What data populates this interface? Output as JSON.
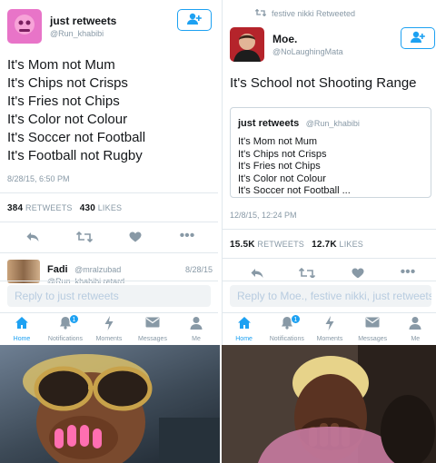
{
  "left": {
    "user": {
      "name": "just retweets",
      "handle": "@Run_khabibi"
    },
    "tweet_text": "It's Mom not Mum\nIt's Chips not Crisps\nIt's Fries not Chips\nIt's Color not Colour\nIt's Soccer not Football\nIt's Football not Rugby",
    "timestamp": "8/28/15, 6:50 PM",
    "retweet_count": "384",
    "retweets_label": "RETWEETS",
    "like_count": "430",
    "likes_label": "LIKES",
    "reply_preview": {
      "name": "Fadi",
      "handle": "@mralzubad",
      "date": "8/28/15",
      "snippet": "@Run_khabibi retard"
    },
    "reply_placeholder": "Reply to just retweets"
  },
  "right": {
    "retweeted_by": "festive nikki Retweeted",
    "user": {
      "name": "Moe.",
      "handle": "@NoLaughingMata"
    },
    "tweet_text": "It's School not Shooting Range",
    "quote": {
      "name": "just retweets",
      "handle": "@Run_khabibi",
      "text": "It's Mom not Mum\nIt's Chips not Crisps\nIt's Fries not Chips\nIt's Color not Colour\nIt's Soccer not Football ..."
    },
    "timestamp": "12/8/15, 12:24 PM",
    "retweet_count": "15.5K",
    "retweets_label": "RETWEETS",
    "like_count": "12.7K",
    "likes_label": "LIKES",
    "reply_placeholder": "Reply to Moe., festive nikki, just retweets"
  },
  "tabs": [
    {
      "label": "Home",
      "icon": "home-icon"
    },
    {
      "label": "Notifications",
      "icon": "bell-icon",
      "badge": "1"
    },
    {
      "label": "Moments",
      "icon": "lightning-icon"
    },
    {
      "label": "Messages",
      "icon": "envelope-icon"
    },
    {
      "label": "Me",
      "icon": "person-icon"
    }
  ],
  "colors": {
    "accent": "#1da1f2",
    "text": "#14171a",
    "muted": "#8899a6",
    "divider": "#e1e8ed"
  }
}
